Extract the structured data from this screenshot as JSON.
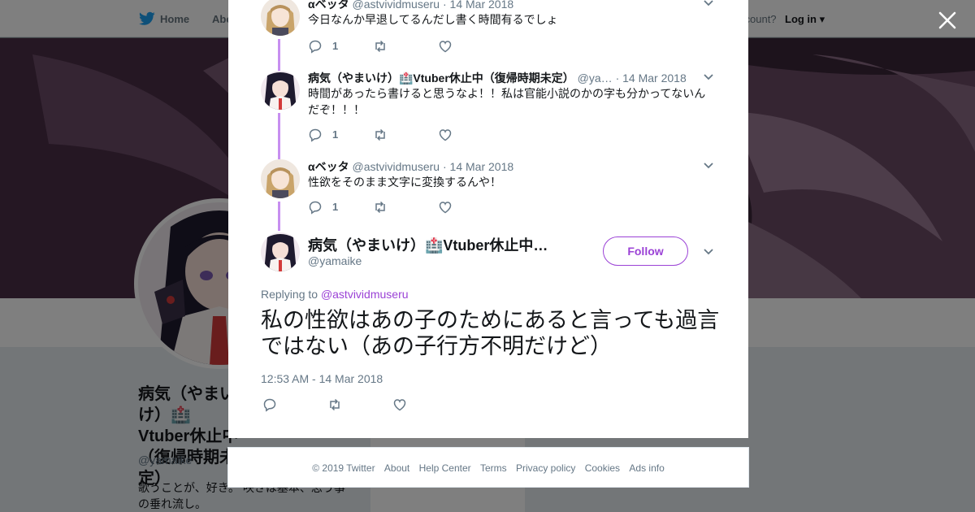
{
  "nav": {
    "home": "Home",
    "about": "Abo",
    "have_account": "ccount?",
    "login": "Log in"
  },
  "profile_bg": {
    "name": "病気（やまいけ）🏥Vtuber休止中（復帰時期未定）",
    "handle": "@yamaike",
    "bio": "歌うことが、好き。 咲きは基本、思う事の垂れ流し。",
    "card_text": "Ads info"
  },
  "replies": [
    {
      "name": "αベッタ",
      "handle": "@astvividmuseru",
      "sep": "·",
      "date": "14 Mar 2018",
      "text": "今日なんか早退してるんだし書く時間有るでしょ",
      "reply_count": "1"
    },
    {
      "name": "病気（やまいけ）🏥Vtuber休止中（復帰時期未定）",
      "handle": "@ya…",
      "sep": "·",
      "date": "14 Mar 2018",
      "text": "時間があったら書けると思うなよ！！私は官能小説のかの字も分かってないんだぞ！！！",
      "reply_count": "1"
    },
    {
      "name": "αベッタ",
      "handle": "@astvividmuseru",
      "sep": "·",
      "date": "14 Mar 2018",
      "text": "性欲をそのまま文字に変換するんや！",
      "reply_count": "1"
    }
  ],
  "main_tweet": {
    "name": "病気（やまいけ）🏥Vtuber休止中…",
    "handle": "@yamaike",
    "follow_label": "Follow",
    "replying_prefix": "Replying to",
    "replying_to": "@astvividmuseru",
    "text": "私の性欲はあの子のためにあると言っても過言ではない（あの子行方不明だけど）",
    "timestamp": "12:53 AM - 14 Mar 2018"
  },
  "footer": {
    "items": [
      "© 2019 Twitter",
      "About",
      "Help Center",
      "Terms",
      "Privacy policy",
      "Cookies",
      "Ads info"
    ]
  },
  "icons": {
    "brand": "twitter-bird-icon",
    "close": "close-icon",
    "reply": "reply-icon",
    "retweet": "retweet-icon",
    "like": "heart-icon",
    "more": "chevron-down-icon"
  },
  "colors": {
    "accent": "#9b42d6",
    "thread": "#c78ff0",
    "brand": "#1da1f2"
  }
}
